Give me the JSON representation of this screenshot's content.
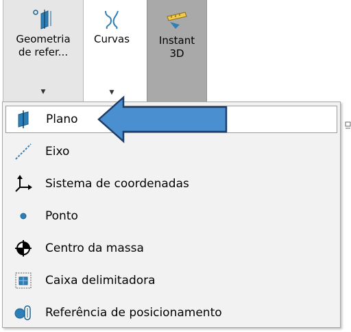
{
  "ribbon": {
    "geometria": {
      "line1": "Geometria",
      "line2": "de refer...",
      "icon": "reference-plane-icon"
    },
    "curvas": {
      "label": "Curvas",
      "icon": "curves-icon"
    },
    "instant3d": {
      "line1": "Instant",
      "line2": "3D",
      "icon": "instant3d-ruler-icon"
    }
  },
  "menu": {
    "items": [
      {
        "label": "Plano",
        "icon": "plane-icon"
      },
      {
        "label": "Eixo",
        "icon": "axis-icon"
      },
      {
        "label": "Sistema de coordenadas",
        "icon": "coordinate-system-icon"
      },
      {
        "label": "Ponto",
        "icon": "point-icon"
      },
      {
        "label": "Centro da massa",
        "icon": "center-of-mass-icon"
      },
      {
        "label": "Caixa delimitadora",
        "icon": "bounding-box-icon"
      },
      {
        "label": "Referência de posicionamento",
        "icon": "mate-reference-icon"
      }
    ]
  },
  "colors": {
    "arrow_fill": "#4a8fcf",
    "arrow_stroke": "#1f3b66",
    "icon_blue": "#2e7eb8"
  }
}
